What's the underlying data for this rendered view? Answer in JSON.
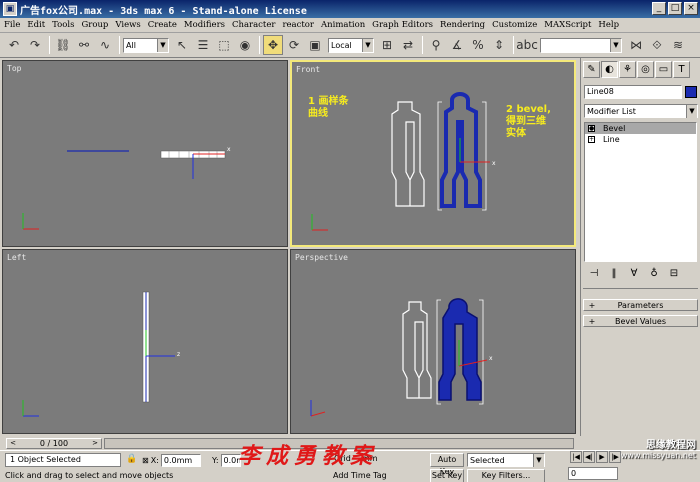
{
  "window": {
    "title": "广告fox公司.max - 3ds max 6 - Stand-alone License",
    "controls": [
      "_",
      "□",
      "×"
    ]
  },
  "menu": [
    "File",
    "Edit",
    "Tools",
    "Group",
    "Views",
    "Create",
    "Modifiers",
    "Character",
    "reactor",
    "Animation",
    "Graph Editors",
    "Rendering",
    "Customize",
    "MAXScript",
    "Help"
  ],
  "toolbar": {
    "selection_filter": "All",
    "coord_system": "Local"
  },
  "viewports": {
    "top": {
      "label": "Top"
    },
    "front": {
      "label": "Front",
      "note1_line1": "1 画样条",
      "note1_line2": "曲线",
      "note2_line1": "2 bevel,",
      "note2_line2": "得到三维",
      "note2_line3": "实体"
    },
    "left": {
      "label": "Left"
    },
    "perspective": {
      "label": "Perspective"
    }
  },
  "command_panel": {
    "object_name": "Line08",
    "object_color": "#1a2ab0",
    "modifier_list": "Modifier List",
    "stack": [
      {
        "name": "Bevel",
        "selected": true
      },
      {
        "name": "Line",
        "selected": false
      }
    ],
    "rollouts": [
      {
        "name": "Parameters",
        "toggle": "+"
      },
      {
        "name": "Bevel Values",
        "toggle": "+"
      }
    ]
  },
  "timeline": {
    "slider_label": "0 / 100",
    "prev": "<",
    "next": ">"
  },
  "status": {
    "selection": "1 Object Selected",
    "prompt": "Click and drag to select and move objects",
    "x_label": "X:",
    "x_value": "0.0mm",
    "y_label": "Y:",
    "y_value": "0.0mm",
    "grid_fragment": "Grid",
    "z_fragment": "mm",
    "add_time_tag": "Add Time Tag",
    "auto_key": "Auto Key",
    "set_key": "Set Key",
    "key_mode": "Selected",
    "key_filters": "Key Filters...",
    "frame": "0"
  },
  "watermarks": {
    "author": "李成勇教案",
    "site_cn": "思缘教程网",
    "site_url": "www.missyuan.net"
  }
}
